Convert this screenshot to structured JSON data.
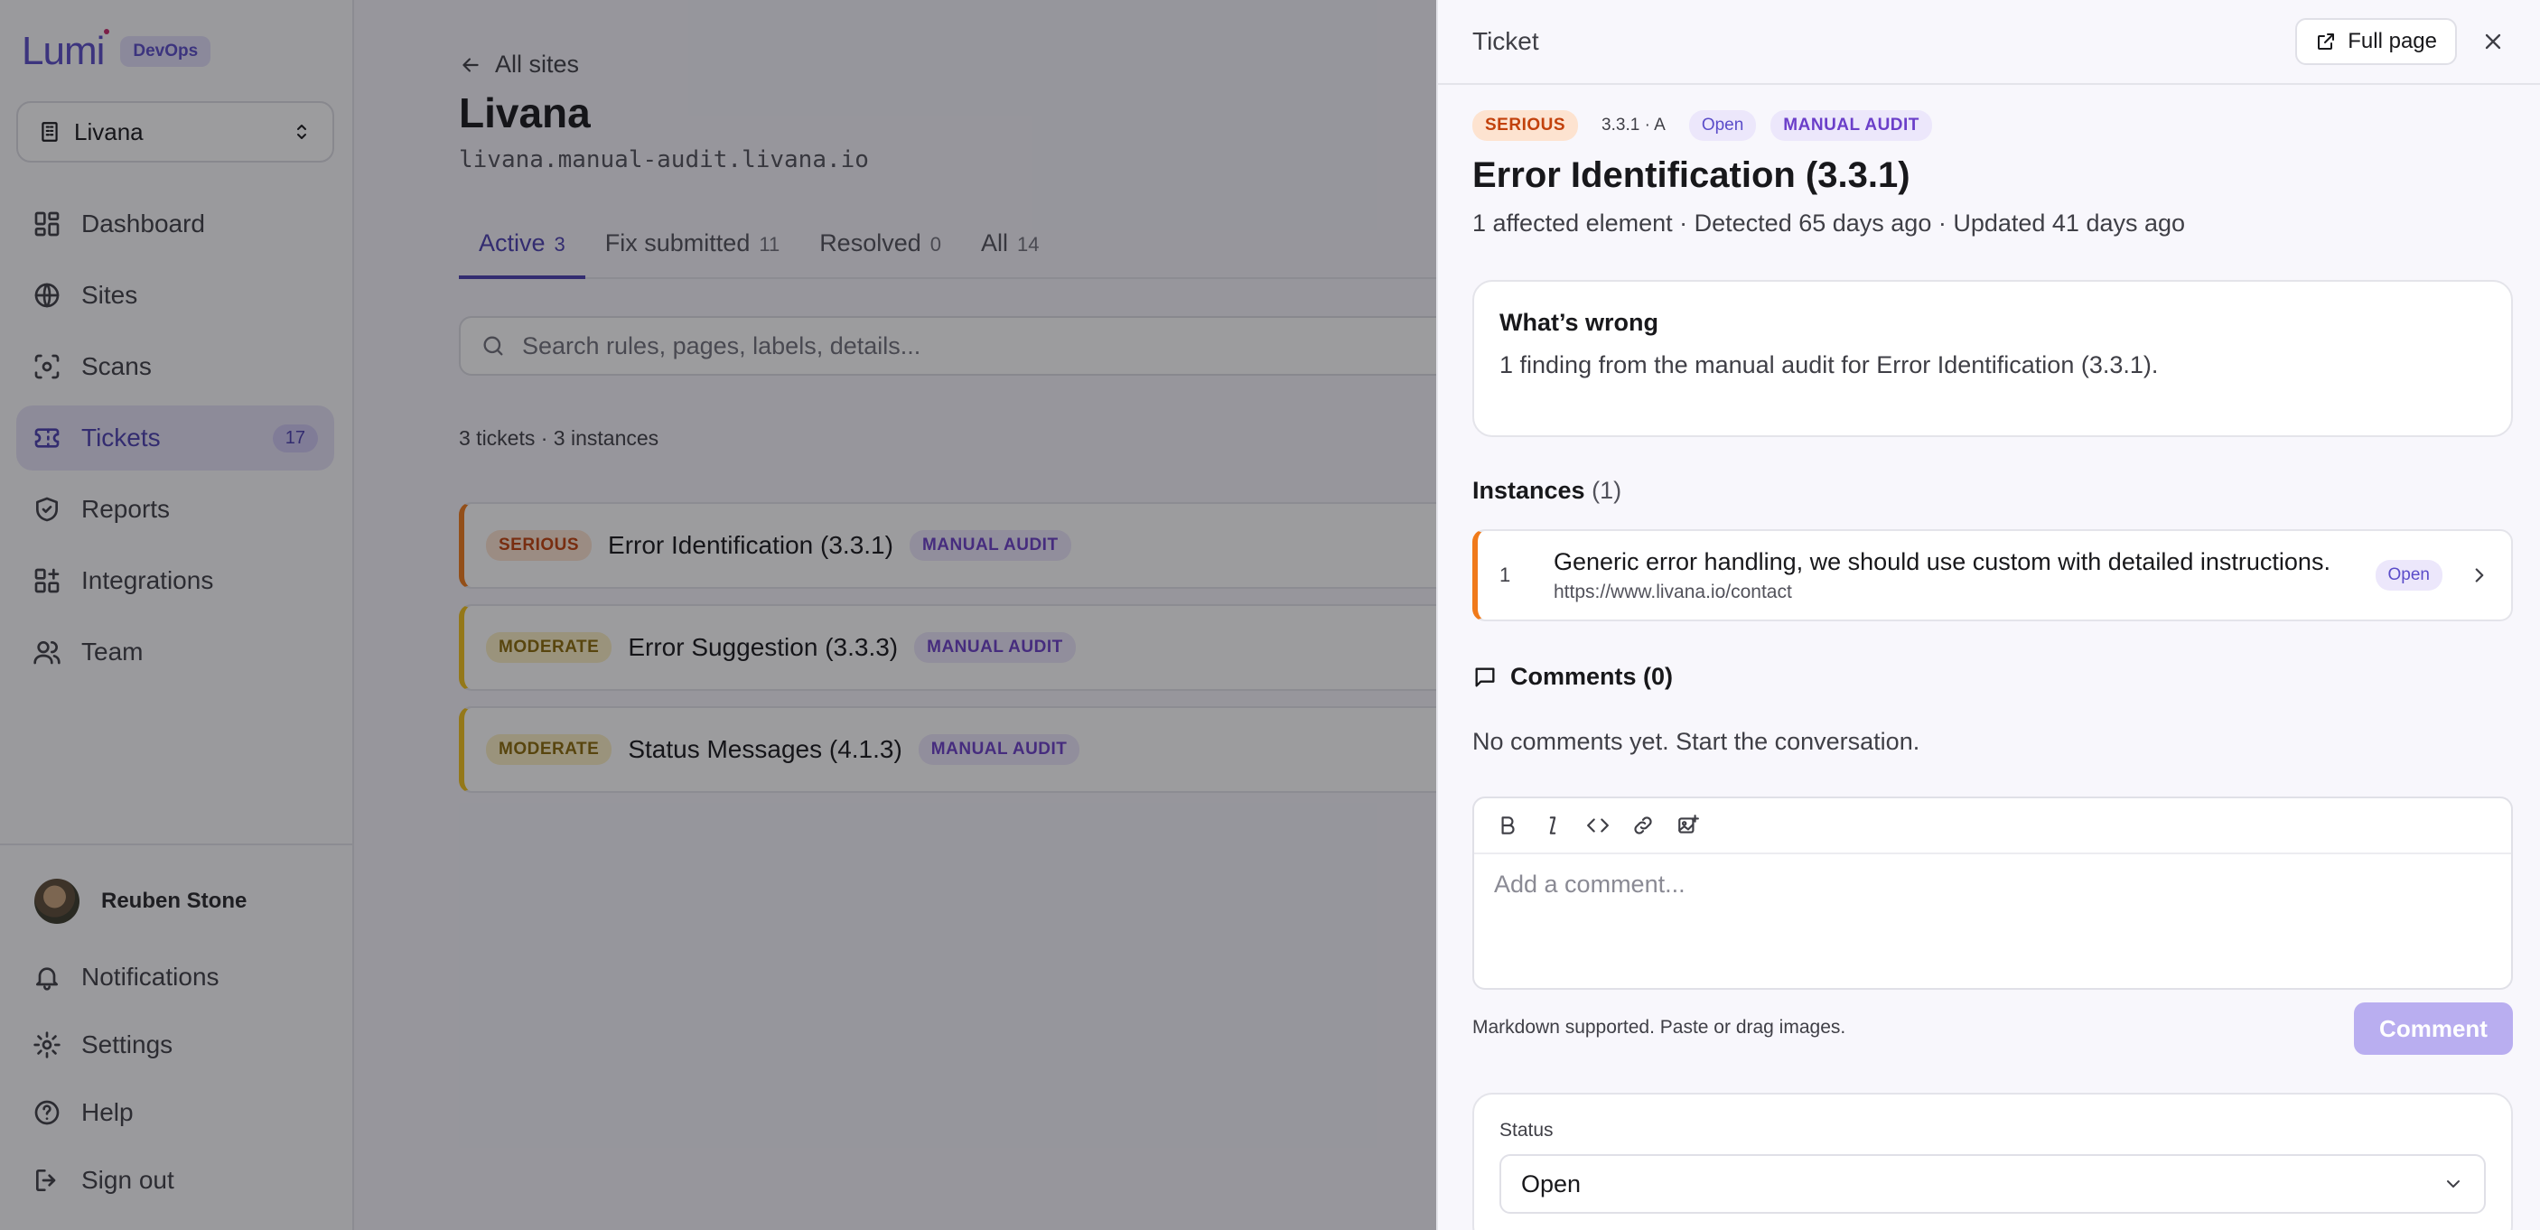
{
  "brand": {
    "logo": "Lumi",
    "env": "DevOps"
  },
  "site_selector": {
    "value": "Livana"
  },
  "nav": [
    {
      "label": "Dashboard",
      "icon": "dashboard-icon"
    },
    {
      "label": "Sites",
      "icon": "globe-icon"
    },
    {
      "label": "Scans",
      "icon": "scan-icon"
    },
    {
      "label": "Tickets",
      "icon": "ticket-icon",
      "badge": "17",
      "active": true
    },
    {
      "label": "Reports",
      "icon": "shield-icon"
    },
    {
      "label": "Integrations",
      "icon": "integrations-icon"
    },
    {
      "label": "Team",
      "icon": "team-icon"
    }
  ],
  "user": {
    "name": "Reuben Stone"
  },
  "footer_nav": [
    {
      "label": "Notifications",
      "icon": "bell-icon"
    },
    {
      "label": "Settings",
      "icon": "gear-icon"
    },
    {
      "label": "Help",
      "icon": "help-icon"
    },
    {
      "label": "Sign out",
      "icon": "sign-out-icon"
    }
  ],
  "page": {
    "back_label": "All sites",
    "title": "Livana",
    "url": "livana.manual-audit.livana.io",
    "tabs": [
      {
        "label": "Active",
        "count": "3"
      },
      {
        "label": "Fix submitted",
        "count": "11"
      },
      {
        "label": "Resolved",
        "count": "0"
      },
      {
        "label": "All",
        "count": "14"
      }
    ],
    "search_placeholder": "Search rules, pages, labels, details...",
    "summary": "3 tickets · 3 instances",
    "tickets": [
      {
        "severity": "SERIOUS",
        "title": "Error Identification (3.3.1)",
        "tag": "MANUAL AUDIT"
      },
      {
        "severity": "MODERATE",
        "title": "Error Suggestion (3.3.3)",
        "tag": "MANUAL AUDIT"
      },
      {
        "severity": "MODERATE",
        "title": "Status Messages (4.1.3)",
        "tag": "MANUAL AUDIT"
      }
    ]
  },
  "drawer": {
    "label": "Ticket",
    "full_page": "Full page",
    "tags": {
      "severity": "SERIOUS",
      "criterion": "3.3.1 · A",
      "status": "Open",
      "source": "MANUAL AUDIT"
    },
    "title": "Error Identification (3.3.1)",
    "meta": "1 affected element · Detected 65 days ago · Updated 41 days ago",
    "whats_wrong": {
      "heading": "What’s wrong",
      "text": "1 finding from the manual audit for Error Identification (3.3.1)."
    },
    "instances": {
      "heading": "Instances",
      "count": "(1)",
      "items": [
        {
          "number": "1",
          "description": "Generic error handling, we should use custom with detailed instructions.",
          "url": "https://www.livana.io/contact",
          "status": "Open"
        }
      ]
    },
    "comments": {
      "heading": "Comments (0)",
      "empty": "No comments yet. Start the conversation.",
      "placeholder": "Add a comment...",
      "hint": "Markdown supported. Paste or drag images.",
      "submit": "Comment"
    },
    "status": {
      "label": "Status",
      "value": "Open"
    }
  }
}
